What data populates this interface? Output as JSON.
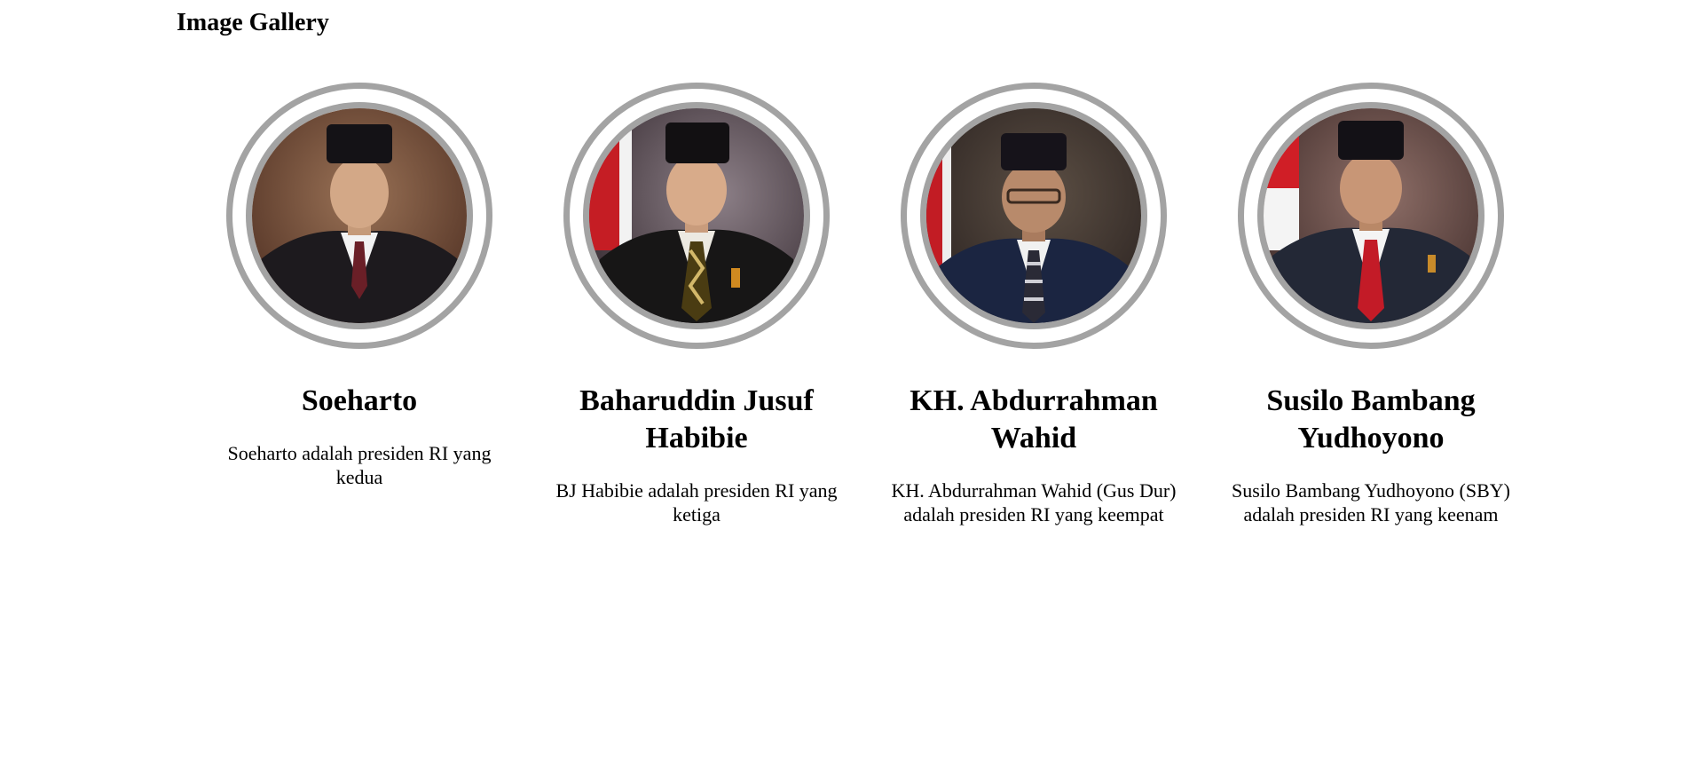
{
  "page": {
    "title": "Image Gallery"
  },
  "colors": {
    "ring": "#a3a3a3",
    "background": "#ffffff",
    "text": "#000000"
  },
  "gallery": [
    {
      "name": "Soeharto",
      "description": "Soeharto adalah presiden RI yang kedua",
      "portrait_icon": "portrait-photo-icon"
    },
    {
      "name": "Baharuddin Jusuf Habibie",
      "description": "BJ Habibie adalah presiden RI yang ketiga",
      "portrait_icon": "portrait-photo-icon"
    },
    {
      "name": "KH. Abdurrahman Wahid",
      "description": "KH. Abdurrahman Wahid (Gus Dur) adalah presiden RI yang keempat",
      "portrait_icon": "portrait-photo-icon"
    },
    {
      "name": "Susilo Bambang Yudhoyono",
      "description": "Susilo Bambang Yudhoyono (SBY) adalah presiden RI yang keenam",
      "portrait_icon": "portrait-photo-icon"
    }
  ]
}
